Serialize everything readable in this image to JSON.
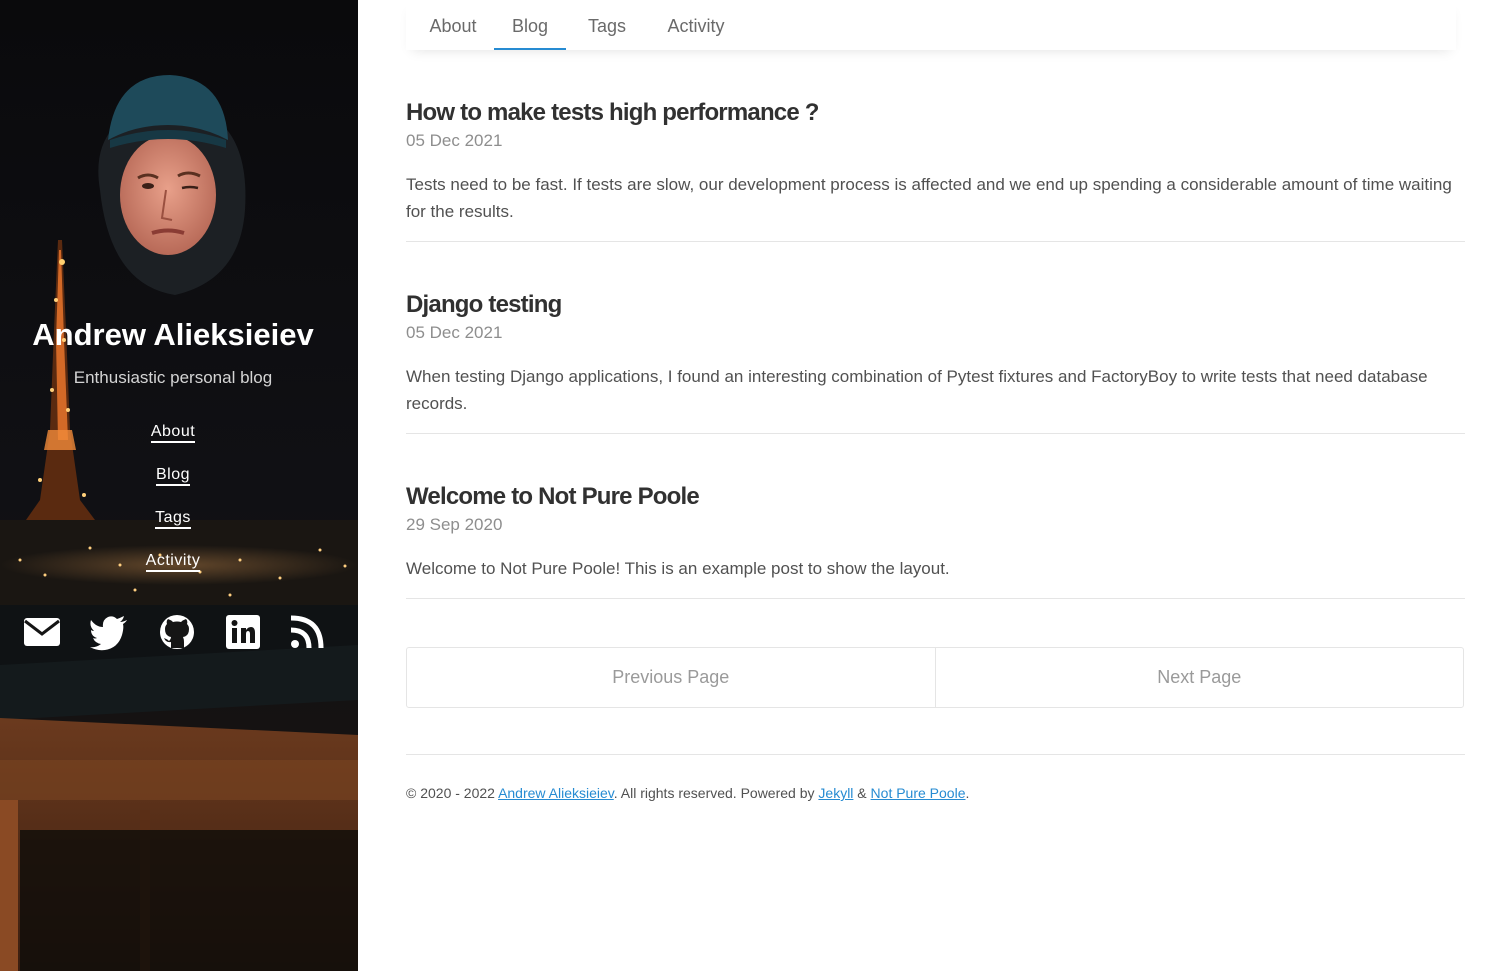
{
  "sidebar": {
    "author_name": "Andrew Alieksieiev",
    "tagline": "Enthusiastic personal blog",
    "nav": [
      {
        "label": "About"
      },
      {
        "label": "Blog"
      },
      {
        "label": "Tags"
      },
      {
        "label": "Activity"
      }
    ],
    "social_icons": [
      "mail-icon",
      "twitter-icon",
      "github-icon",
      "linkedin-icon",
      "rss-icon"
    ]
  },
  "topnav": {
    "tabs": [
      {
        "label": "About"
      },
      {
        "label": "Blog",
        "active": true
      },
      {
        "label": "Tags"
      },
      {
        "label": "Activity"
      }
    ]
  },
  "posts": [
    {
      "title": "How to make tests high performance ?",
      "date": "05 Dec 2021",
      "excerpt": "Tests need to be fast. If tests are slow, our development process is affected and we end up spending a considerable amount of time waiting for the results."
    },
    {
      "title": "Django testing",
      "date": "05 Dec 2021",
      "excerpt": "When testing Django applications, I found an interesting combination of Pytest fixtures and FactoryBoy to write tests that need data­base records."
    },
    {
      "title": "Welcome to Not Pure Poole",
      "date": "29 Sep 2020",
      "excerpt": "Welcome to Not Pure Poole! This is an example post to show the layout."
    }
  ],
  "pagination": {
    "previous_label": "Previous Page",
    "next_label": "Next Page"
  },
  "footer": {
    "prefix": "© 2020 - 2022 ",
    "author_link": "Andrew Alieksieiev",
    "middle": ". All rights reserved. Powered by ",
    "jekyll_link": "Jekyll",
    "amp": " & ",
    "theme_link": "Not Pure Poole",
    "suffix": "."
  },
  "colors": {
    "accent": "#268bd2",
    "sidebar_bg": "#0d0d0f",
    "text": "#515151",
    "title": "#313131"
  }
}
